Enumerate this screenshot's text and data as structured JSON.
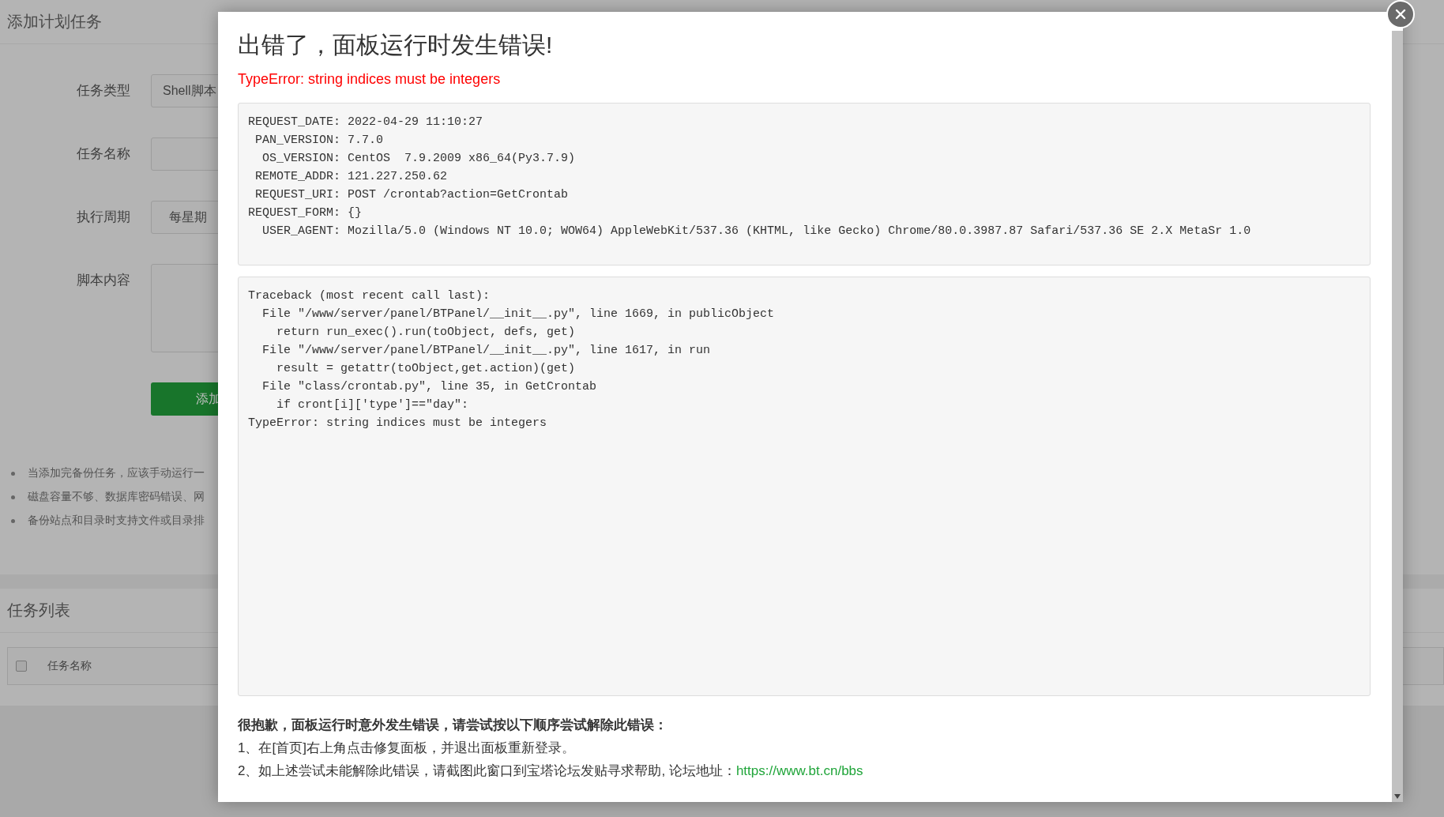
{
  "page_title": "添加计划任务",
  "form": {
    "fields": [
      {
        "label": "任务类型",
        "kind": "select",
        "value": "Shell脚本"
      },
      {
        "label": "任务名称",
        "kind": "input"
      },
      {
        "label": "执行周期",
        "kind": "select",
        "value": "每星期"
      },
      {
        "label": "脚本内容",
        "kind": "textarea"
      }
    ],
    "submit_button": "添加"
  },
  "tips": [
    "当添加完备份任务，应该手动运行一",
    "磁盘容量不够、数据库密码错误、网",
    "备份站点和目录时支持文件或目录排"
  ],
  "task_list": {
    "title": "任务列表",
    "select_all": {
      "checked": false
    },
    "columns": [
      "任务名称"
    ]
  },
  "error_dialog": {
    "title": "出错了，面板运行时发生错误!",
    "error_message": "TypeError: string indices must be integers",
    "request_info": [
      {
        "key": "REQUEST_DATE:",
        "value": "2022-04-29 11:10:27"
      },
      {
        "key": "PAN_VERSION:",
        "value": "7.7.0"
      },
      {
        "key": "OS_VERSION:",
        "value": "CentOS  7.9.2009 x86_64(Py3.7.9)"
      },
      {
        "key": "REMOTE_ADDR:",
        "value": "121.227.250.62"
      },
      {
        "key": "REQUEST_URI:",
        "value": "POST /crontab?action=GetCrontab"
      },
      {
        "key": "REQUEST_FORM:",
        "value": "{}"
      },
      {
        "key": "USER_AGENT:",
        "value": "Mozilla/5.0 (Windows NT 10.0; WOW64) AppleWebKit/537.36 (KHTML, like Gecko) Chrome/80.0.3987.87 Safari/537.36 SE 2.X MetaSr 1.0"
      }
    ],
    "traceback": [
      {
        "text": "Traceback (most recent call last):",
        "children": [
          {
            "text": "File \"/www/server/panel/BTPanel/__init__.py\", line 1669, in publicObject",
            "children": [
              {
                "text": "return run_exec().run(toObject, defs, get)"
              }
            ]
          },
          {
            "text": "File \"/www/server/panel/BTPanel/__init__.py\", line 1617, in run",
            "children": [
              {
                "text": "result = getattr(toObject,get.action)(get)"
              }
            ]
          },
          {
            "text": "File \"class/crontab.py\", line 35, in GetCrontab",
            "children": [
              {
                "text": "if cront[i]['type']==\"day\":"
              }
            ]
          }
        ]
      },
      {
        "text": "TypeError: string indices must be integers"
      }
    ],
    "help_heading": "很抱歉，面板运行时意外发生错误，请尝试按以下顺序尝试解除此错误：",
    "help_steps": [
      {
        "text": "1、在[首页]右上角点击修复面板，并退出面板重新登录。"
      },
      {
        "text": "2、如上述尝试未能解除此错误，请截图此窗口到宝塔论坛发贴寻求帮助, 论坛地址：",
        "link": "https://www.bt.cn/bbs"
      }
    ]
  }
}
